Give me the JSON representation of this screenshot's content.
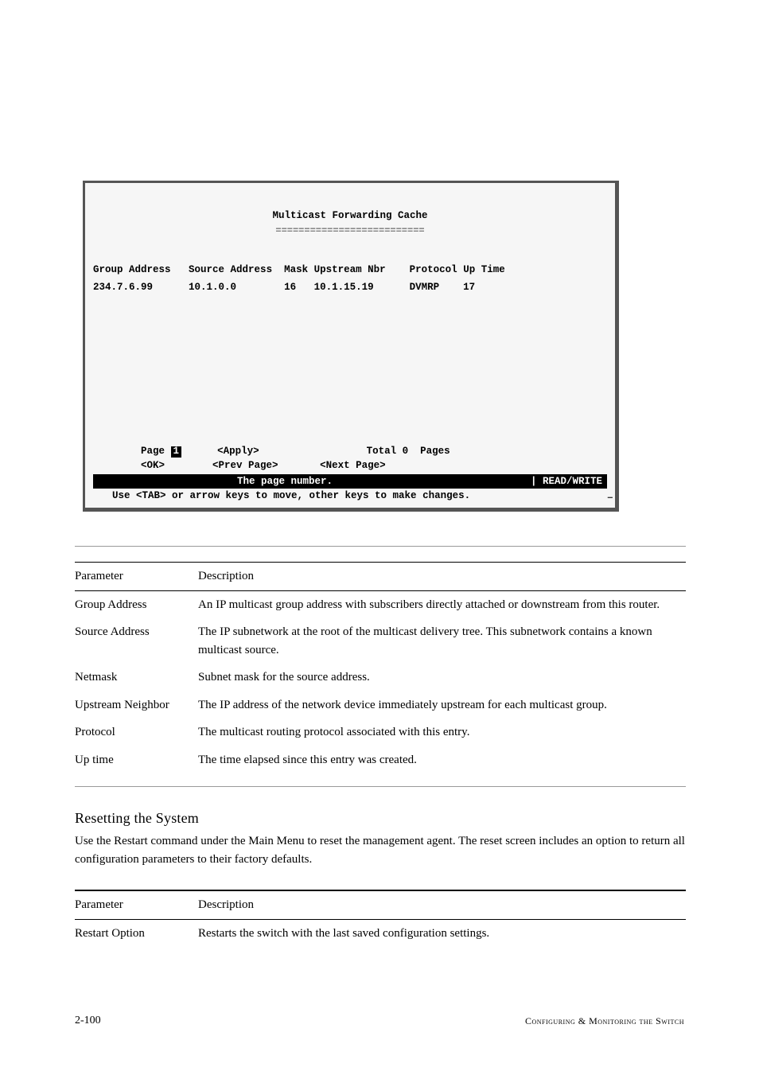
{
  "terminal": {
    "title": "Multicast Forwarding Cache",
    "underline": "==========================",
    "headers": {
      "group": "Group Address",
      "source": "Source Address",
      "mask": "Mask",
      "upstream": "Upstream Nbr",
      "protocol": "Protocol",
      "uptime": "Up Time"
    },
    "row": {
      "group": "234.7.6.99",
      "source": "10.1.0.0",
      "mask": "16",
      "upstream": "10.1.15.19",
      "protocol": "DVMRP",
      "uptime": "17"
    },
    "nav": {
      "page_label": "Page",
      "page_value": "1",
      "apply": "<Apply>",
      "total_label": "Total",
      "total_value": "0",
      "pages_label": "Pages",
      "ok": "<OK>",
      "prev": "<Prev Page>",
      "next": "<Next Page>"
    },
    "status_left": "The page number.",
    "status_right": "| READ/WRITE",
    "hint": "Use <TAB> or arrow keys to move, other keys to make changes."
  },
  "params_table": {
    "header_param": "Parameter",
    "header_desc": "Description",
    "rows": [
      {
        "param": "Group Address",
        "desc": "An IP multicast group address with subscribers directly attached or downstream from this router."
      },
      {
        "param": "Source Address",
        "desc": "The IP subnetwork at the root of the multicast delivery tree. This subnetwork contains a known multicast source."
      },
      {
        "param": "Netmask",
        "desc": "Subnet mask for the source address."
      },
      {
        "param": "Upstream Neighbor",
        "desc": "The IP address of the network device immediately upstream for each multicast group."
      },
      {
        "param": "Protocol",
        "desc": "The multicast routing protocol associated with this entry."
      },
      {
        "param": "Up time",
        "desc": "The time elapsed since this entry was created."
      }
    ]
  },
  "section_heading": "Resetting the System",
  "section_body": "Use the Restart command under the Main Menu to reset the management agent. The reset screen includes an option to return all configuration parameters to their factory defaults.",
  "restart_table": {
    "header_param": "Parameter",
    "header_desc": "Description",
    "rows": [
      {
        "param": "Restart Option",
        "desc": "Restarts the switch with the last saved configuration settings."
      }
    ]
  },
  "footer": {
    "page_number": "2-100",
    "running_head": "Configuring & Monitoring the Switch"
  }
}
